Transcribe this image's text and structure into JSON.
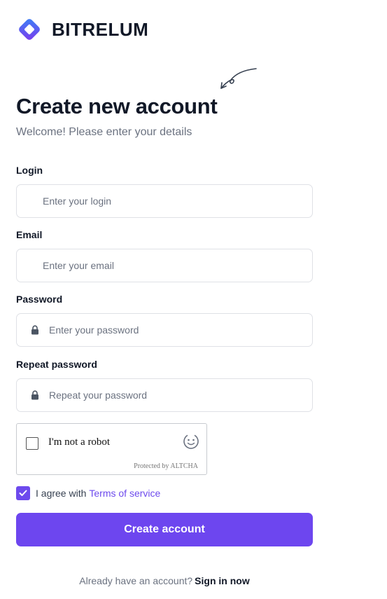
{
  "brand": {
    "name": "BITRELUM",
    "logo_icon": "diamond-logo-icon",
    "accent": "#6d46ef"
  },
  "heading": {
    "title": "Create new account",
    "subtitle": "Welcome! Please enter your details"
  },
  "form": {
    "login": {
      "label": "Login",
      "placeholder": "Enter your login",
      "value": ""
    },
    "email": {
      "label": "Email",
      "placeholder": "Enter your email",
      "value": ""
    },
    "password": {
      "label": "Password",
      "placeholder": "Enter your password",
      "value": "",
      "icon": "lock-icon"
    },
    "repeat_password": {
      "label": "Repeat password",
      "placeholder": "Repeat your password",
      "value": "",
      "icon": "lock-icon"
    }
  },
  "captcha": {
    "label": "I'm not a robot",
    "footer": "Protected by ALTCHA",
    "checked": false
  },
  "terms": {
    "checked": true,
    "text": "I agree with",
    "link": "Terms of service"
  },
  "submit": {
    "label": "Create account"
  },
  "footer": {
    "text": "Already have an account?",
    "link": "Sign in now"
  }
}
